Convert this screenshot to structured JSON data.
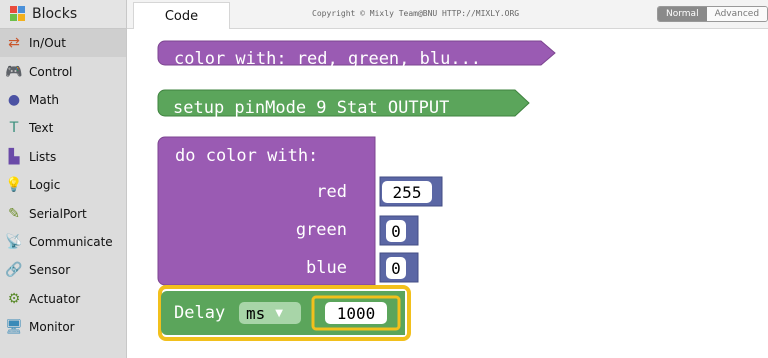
{
  "sidebar": {
    "title": "Blocks",
    "items": [
      {
        "label": "In/Out",
        "icon": "in-out-icon",
        "glyph": "⇄",
        "color": "#c9572c",
        "selected": true
      },
      {
        "label": "Control",
        "icon": "gamepad-icon",
        "glyph": "🎮",
        "color": "#3d8b3d"
      },
      {
        "label": "Math",
        "icon": "math-icon",
        "glyph": "●",
        "color": "#4b52a3"
      },
      {
        "label": "Text",
        "icon": "text-icon",
        "glyph": "T",
        "color": "#3a8f7c"
      },
      {
        "label": "Lists",
        "icon": "lists-icon",
        "glyph": "▙",
        "color": "#6a4aa8"
      },
      {
        "label": "Logic",
        "icon": "bulb-icon",
        "glyph": "💡",
        "color": "#4a7bb8"
      },
      {
        "label": "SerialPort",
        "icon": "serial-icon",
        "glyph": "✎",
        "color": "#6d8d2a"
      },
      {
        "label": "Communicate",
        "icon": "satellite-icon",
        "glyph": "📡",
        "color": "#3a9b5a"
      },
      {
        "label": "Sensor",
        "icon": "sensor-icon",
        "glyph": "🔗",
        "color": "#b8732a"
      },
      {
        "label": "Actuator",
        "icon": "actuator-icon",
        "glyph": "⚙",
        "color": "#5a8a2a"
      },
      {
        "label": "Monitor",
        "icon": "monitor-icon",
        "glyph": "🖥",
        "color": "#3a8ab8"
      }
    ]
  },
  "topbar": {
    "tab_label": "Code",
    "copyright": "Copyright © Mixly Team@BNU HTTP://MIXLY.ORG",
    "mode_normal": "Normal",
    "mode_advanced": "Advanced"
  },
  "blocks": {
    "color_call": "color with: red, green, blu...",
    "setup": "setup pinMode 9 Stat OUTPUT",
    "proc_header": "do color with:",
    "params": [
      {
        "label": "red",
        "value": "255"
      },
      {
        "label": "green",
        "value": "0"
      },
      {
        "label": "blue",
        "value": "0"
      }
    ],
    "delay_label": "Delay",
    "delay_unit": "ms",
    "delay_value": "1000"
  },
  "colors": {
    "purple": "#9a5bb3",
    "green": "#5ba55b",
    "math_blue": "#5b67a5",
    "highlight": "#f2c01c"
  }
}
